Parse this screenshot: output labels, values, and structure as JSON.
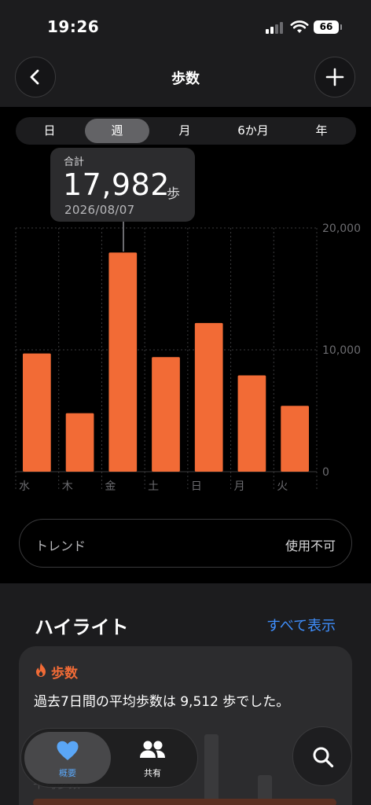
{
  "status_bar": {
    "time": "19:26",
    "battery": "66"
  },
  "header": {
    "title": "歩数",
    "back_icon": "chevron-left-icon",
    "add_icon": "plus-icon"
  },
  "segments": [
    {
      "label": "日",
      "active": false
    },
    {
      "label": "週",
      "active": true
    },
    {
      "label": "月",
      "active": false
    },
    {
      "label": "6か月",
      "active": false
    },
    {
      "label": "年",
      "active": false
    }
  ],
  "tooltip": {
    "label": "合計",
    "value": "17,982",
    "unit": "歩",
    "date": "2026/08/07"
  },
  "chart_data": {
    "type": "bar",
    "categories": [
      "水",
      "木",
      "金",
      "土",
      "日",
      "月",
      "火"
    ],
    "values": [
      9700,
      4800,
      17982,
      9400,
      12200,
      7900,
      5400
    ],
    "ylim": [
      0,
      20000
    ],
    "y_ticks": [
      {
        "value": 0,
        "label": "0"
      },
      {
        "value": 10000,
        "label": "10,000"
      },
      {
        "value": 20000,
        "label": "20,000"
      }
    ],
    "bar_color": "#f26b36",
    "grid": true,
    "selected_index": 2
  },
  "trend": {
    "label": "トレンド",
    "status": "使用不可"
  },
  "highlights": {
    "title": "ハイライト",
    "show_all": "すべて表示",
    "card": {
      "icon": "flame-icon",
      "category": "歩数",
      "text": "過去7日間の平均歩数は 9,512 歩でした。",
      "partial_label": "平均歩数"
    }
  },
  "tabbar": {
    "items": [
      {
        "label": "概要",
        "icon": "heart-icon",
        "active": true
      },
      {
        "label": "共有",
        "icon": "people-icon",
        "active": false
      }
    ],
    "search_icon": "search-icon"
  },
  "colors": {
    "accent": "#f26b36",
    "link": "#3f8efc",
    "tab_active": "#5aa6f6"
  }
}
